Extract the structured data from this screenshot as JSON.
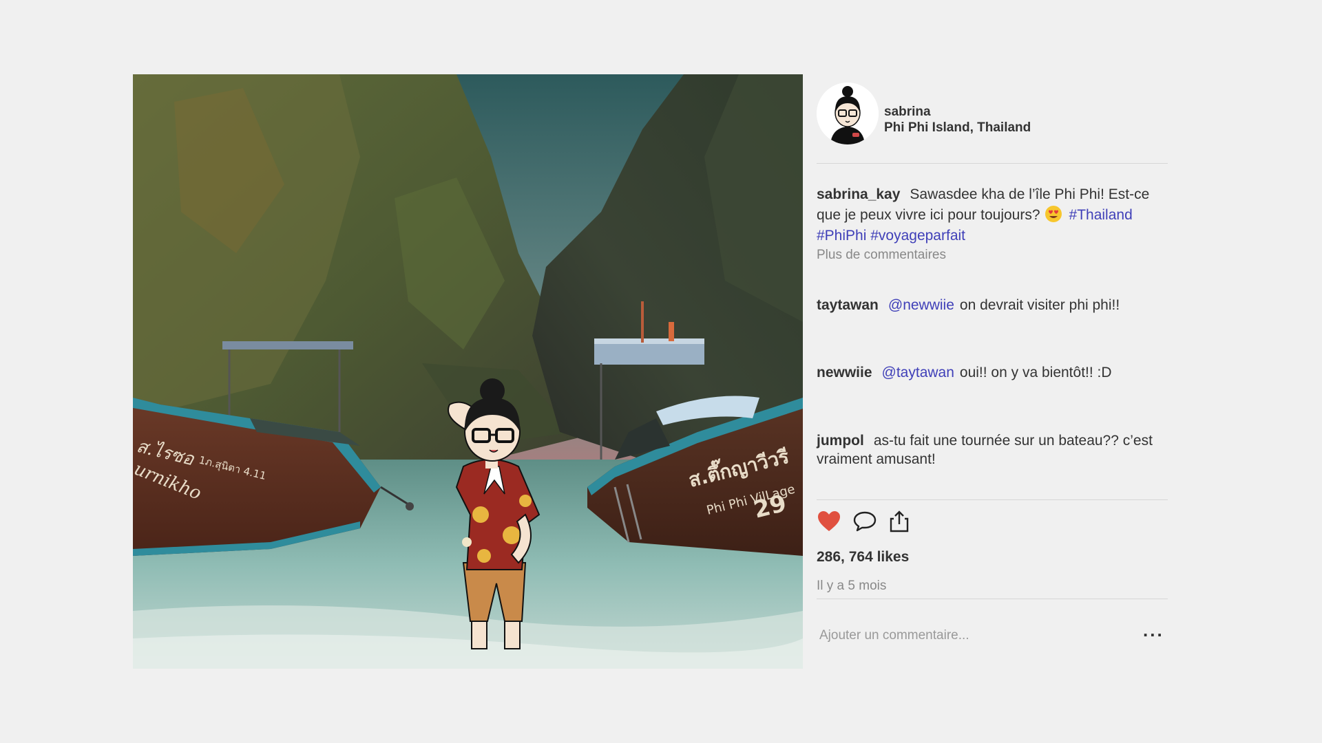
{
  "post": {
    "author": "sabrina",
    "location": "Phi Phi Island, Thailand",
    "caption": {
      "username": "sabrina_kay",
      "text": "Sawasdee kha de l’île Phi Phi! Est-ce que je peux vivre ici pour toujours?",
      "emoji": "smiling-face-with-heart-eyes",
      "hashtags": [
        "#Thailand",
        "#PhiPhi",
        "#voyageparfait"
      ]
    },
    "more_comments_label": "Plus de commentaires",
    "comments": [
      {
        "username": "taytawan",
        "mention": "@newwiie",
        "text": "on devrait visiter phi phi!!"
      },
      {
        "username": "newwiie",
        "mention": "@taytawan",
        "text": "oui!! on y va bientôt!! :D"
      },
      {
        "username": "jumpol",
        "mention": "",
        "text": "as-tu fait une tournée sur un bateau?? c’est vraiment amusant!"
      }
    ],
    "likes": "286, 764 likes",
    "time_ago": "Il y a 5 mois",
    "add_comment_placeholder": "Ajouter un commentaire...",
    "more_options_label": "...",
    "boat_left_text": [
      "ส.ไรซอ",
      "urnikho",
      "1ภ.สุนิตา 4.11"
    ],
    "boat_right_text": [
      "ส.ตึ๊กญาวีวรี",
      "Phi Phi VilLage",
      "29"
    ]
  },
  "icons": {
    "like": "heart-icon",
    "comment": "comment-bubble-icon",
    "share": "share-icon"
  },
  "colors": {
    "like": "#e0503f",
    "hashtag": "#3f3fb8",
    "muted": "#888888",
    "background": "#f0f0f0"
  }
}
